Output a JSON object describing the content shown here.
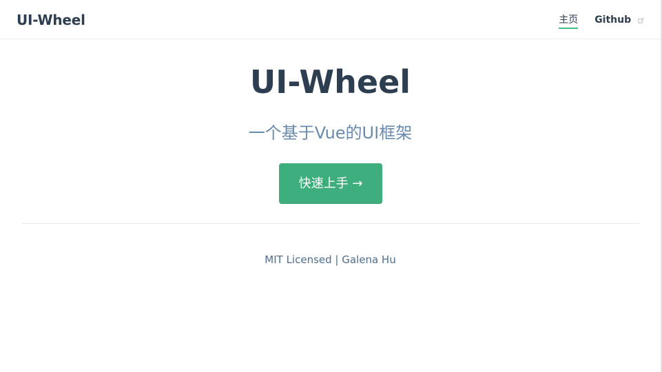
{
  "navbar": {
    "site_name": "UI-Wheel",
    "links": [
      {
        "label": "主页",
        "active": true
      },
      {
        "label": "Github",
        "external": true
      }
    ]
  },
  "hero": {
    "title": "UI-Wheel",
    "description": "一个基于Vue的UI框架",
    "action_label": "快速上手 →"
  },
  "footer": {
    "text": "MIT Licensed | Galena Hu"
  },
  "colors": {
    "accent": "#3eaf7c",
    "text": "#2c3e50",
    "description": "#6a8bad",
    "border": "#eaecef"
  },
  "icons": {
    "external_link": "external-link-icon"
  }
}
